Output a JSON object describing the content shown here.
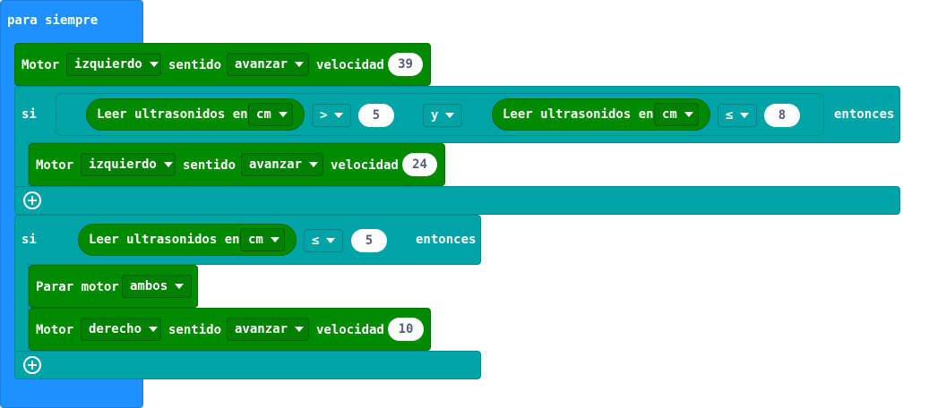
{
  "forever": {
    "label": "para siempre",
    "color": "#1E90FF"
  },
  "motor1": {
    "label": "Motor",
    "motor": "izquierdo",
    "dir_label": "sentido",
    "dir": "avanzar",
    "speed_label": "velocidad",
    "speed": "39"
  },
  "if1": {
    "if_label": "si",
    "left": {
      "label": "Leer ultrasonidos en",
      "unit": "cm",
      "op": ">",
      "value": "5"
    },
    "logic": "y",
    "right": {
      "label": "Leer ultrasonidos en",
      "unit": "cm",
      "op": "≤",
      "value": "8"
    },
    "then_label": "entonces",
    "body": {
      "label": "Motor",
      "motor": "izquierdo",
      "dir_label": "sentido",
      "dir": "avanzar",
      "speed_label": "velocidad",
      "speed": "24"
    }
  },
  "if2": {
    "if_label": "si",
    "cond": {
      "label": "Leer ultrasonidos en",
      "unit": "cm",
      "op": "≤",
      "value": "5"
    },
    "then_label": "entonces",
    "stop": {
      "label": "Parar motor",
      "motor": "ambos"
    },
    "body": {
      "label": "Motor",
      "motor": "derecho",
      "dir_label": "sentido",
      "dir": "avanzar",
      "speed_label": "velocidad",
      "speed": "10"
    }
  },
  "colors": {
    "motors": "#008A00",
    "logic": "#00A4A6"
  }
}
